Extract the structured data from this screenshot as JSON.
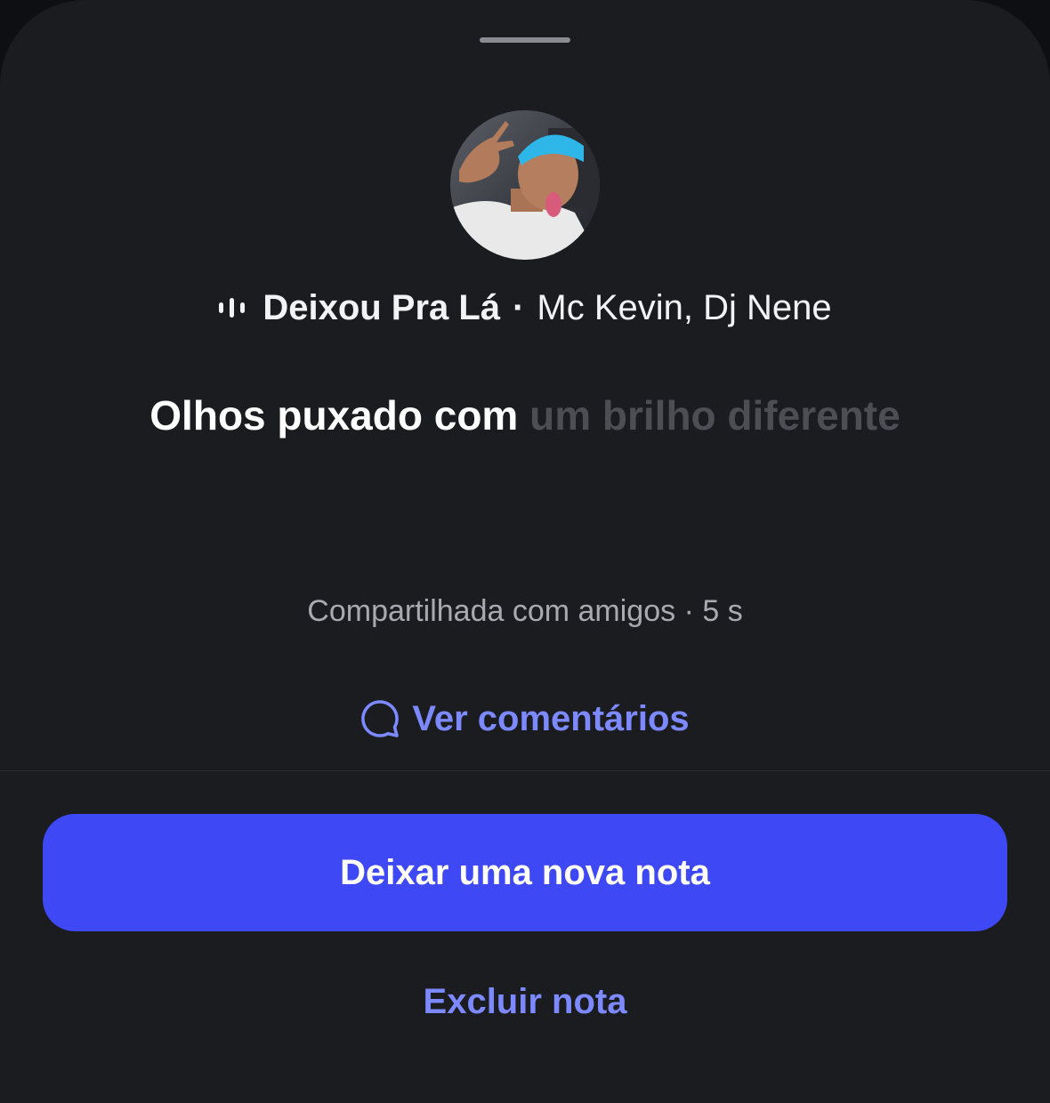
{
  "note": {
    "song_title": "Deixou Pra Lá",
    "separator": "·",
    "artists": "Mc Kevin, Dj Nene",
    "lyric_active": "Olhos puxado com",
    "lyric_upcoming": "um brilho diferente",
    "audience": "Compartilhada com amigos",
    "meta_separator": "·",
    "time_ago": "5 s"
  },
  "actions": {
    "view_comments": "Ver comentários",
    "leave_new_note": "Deixar uma nova nota",
    "delete_note": "Excluir nota"
  },
  "icons": {
    "music": "audio-bars-icon",
    "comments": "speech-bubble-icon"
  },
  "colors": {
    "sheet_background": "#1b1c20",
    "accent_link": "#7c89ff",
    "primary_button": "#3e49f5",
    "lyric_dim": "#4c4e54"
  }
}
